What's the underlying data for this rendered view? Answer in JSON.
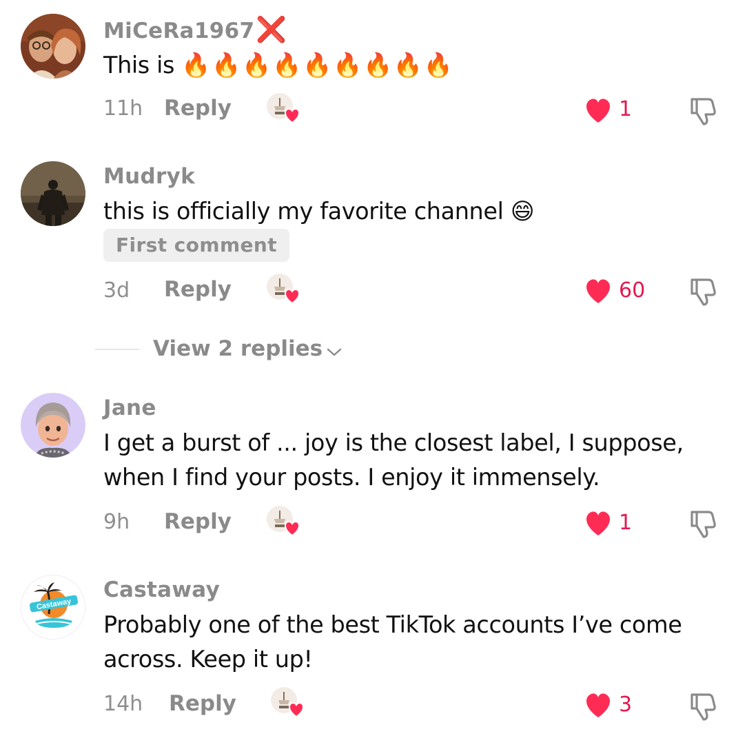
{
  "comments": [
    {
      "username": "MiCeRa1967",
      "username_suffix": "❌",
      "text": "This is",
      "emoji_count": 9,
      "time": "11h",
      "reply_label": "Reply",
      "likes": "1",
      "avatar_icon": "couple-photo-avatar"
    },
    {
      "username": "Mudryk",
      "text": "this is officially my favorite channel 😄",
      "badge": "First comment",
      "time": "3d",
      "reply_label": "Reply",
      "likes": "60",
      "avatar_icon": "armored-figure-avatar",
      "view_replies": "View 2 replies"
    },
    {
      "username": "Jane",
      "text": "I get a burst of ... joy is the closest label, I suppose, when I find your posts. I enjoy it immensely.",
      "time": "9h",
      "reply_label": "Reply",
      "likes": "1",
      "avatar_icon": "memoji-avatar"
    },
    {
      "username": "Castaway",
      "text": "Probably one of the best TikTok accounts I’ve come across. Keep it up!",
      "time": "14h",
      "reply_label": "Reply",
      "likes": "3",
      "avatar_icon": "castaway-logo-avatar"
    }
  ],
  "colors": {
    "like_red": "#fe2c55",
    "username_gray": "#8a8a8a",
    "text_dark": "#111111"
  },
  "icons": {
    "heart": "heart-icon",
    "dislike": "thumbs-down-icon",
    "creator": "creator-liked-icon",
    "chevron": "chevron-down-icon",
    "flame": "fire-emoji"
  }
}
